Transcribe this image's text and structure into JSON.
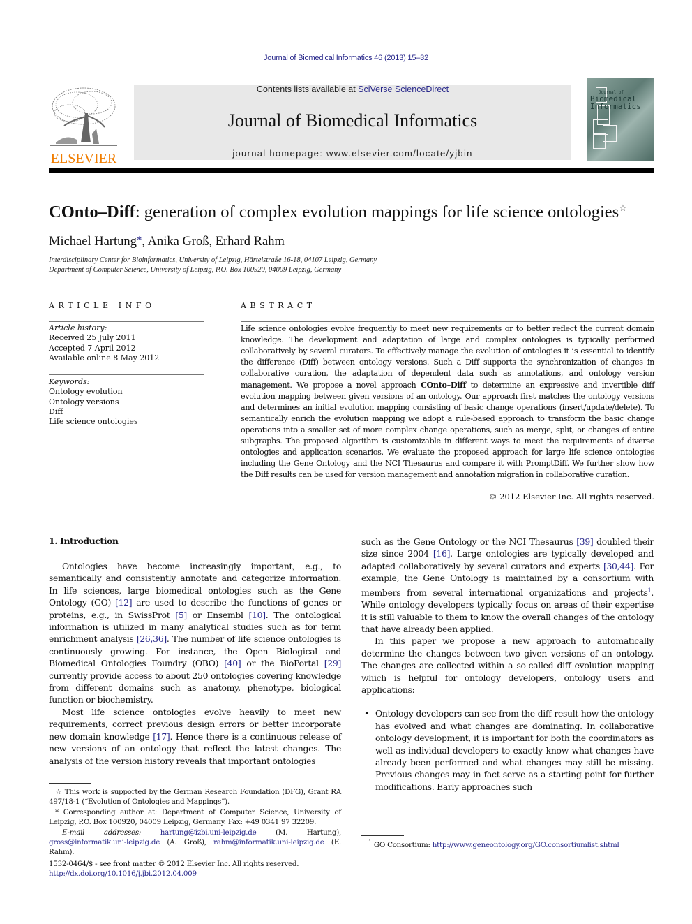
{
  "header": {
    "running_head": "Journal of Biomedical Informatics 46 (2013) 15–32",
    "contents_prefix": "Contents lists available at ",
    "contents_link": "SciVerse ScienceDirect",
    "journal_title": "Journal of Biomedical Informatics",
    "homepage_prefix": "journal homepage: ",
    "homepage_url": "www.elsevier.com/locate/yjbin",
    "publisher_logo_text": "ELSEVIER",
    "publisher_color": "#f07d00",
    "link_color": "#2a2a8c",
    "cover": {
      "line1": "Journal of",
      "line2": "Biomedical",
      "line3": "Informatics"
    }
  },
  "article": {
    "title_bold": "COnto–Diff",
    "title_rest": ": generation of complex evolution mappings for life science ontologies",
    "title_note_mark": "☆",
    "authors": [
      {
        "name": "Michael Hartung",
        "mark": "*"
      },
      {
        "name": ", Anika Groß, Erhard Rahm",
        "mark": ""
      }
    ],
    "affiliations": [
      "Interdisciplinary Center for Bioinformatics, University of Leipzig, Härtelstraße 16-18, 04107 Leipzig, Germany",
      "Department of Computer Science, University of Leipzig, P.O. Box 100920, 04009 Leipzig, Germany"
    ]
  },
  "article_info": {
    "heading": "ARTICLE INFO",
    "history_label": "Article history:",
    "history": [
      "Received 25 July 2011",
      "Accepted 7 April 2012",
      "Available online 8 May 2012"
    ],
    "keywords_label": "Keywords:",
    "keywords": [
      "Ontology evolution",
      "Ontology versions",
      "Diff",
      "Life science ontologies"
    ]
  },
  "abstract": {
    "heading": "ABSTRACT",
    "part1": "Life science ontologies evolve frequently to meet new requirements or to better reflect the current domain knowledge. The development and adaptation of large and complex ontologies is typically performed collaboratively by several curators. To effectively manage the evolution of ontologies it is essential to identify the difference (Diff) between ontology versions. Such a Diff supports the synchronization of changes in collaborative curation, the adaptation of dependent data such as annotations, and ontology version management. We propose a novel approach ",
    "bold": "COnto–Diff",
    "part2": " to determine an expressive and invertible diff evolution mapping between given versions of an ontology. Our approach first matches the ontology versions and determines an initial evolution mapping consisting of basic change operations (insert/update/delete). To semantically enrich the evolution mapping we adopt a rule-based approach to transform the basic change operations into a smaller set of more complex change operations, such as merge, split, or changes of entire subgraphs. The proposed algorithm is customizable in different ways to meet the requirements of diverse ontologies and application scenarios. We evaluate the proposed approach for large life science ontologies including the Gene Ontology and the NCI Thesaurus and compare it with PromptDiff. We further show how the Diff results can be used for version management and annotation migration in collaborative curation.",
    "copyright": "© 2012 Elsevier Inc. All rights reserved."
  },
  "intro": {
    "heading": "1. Introduction",
    "left": {
      "p1": [
        {
          "t": "Ontologies have become increasingly important, e.g., to semantically and consistently annotate and categorize information. In life sciences, large biomedical ontologies such as the Gene Ontology (GO) "
        },
        {
          "ref": "[12]"
        },
        {
          "t": " are used to describe the functions of genes or proteins, e.g., in SwissProt "
        },
        {
          "ref": "[5]"
        },
        {
          "t": " or Ensembl "
        },
        {
          "ref": "[10]"
        },
        {
          "t": ". The ontological information is utilized in many analytical studies such as for term enrichment analysis "
        },
        {
          "ref": "[26,36]"
        },
        {
          "t": ". The number of life science ontologies is continuously growing. For instance, the Open Biological and Biomedical Ontologies Foundry (OBO) "
        },
        {
          "ref": "[40]"
        },
        {
          "t": " or the BioPortal "
        },
        {
          "ref": "[29]"
        },
        {
          "t": " currently provide access to about 250 ontologies covering knowledge from different domains such as anatomy, phenotype, biological function or biochemistry."
        }
      ],
      "p2": [
        {
          "t": "Most life science ontologies evolve heavily to meet new requirements, correct previous design errors or better incorporate new domain knowledge "
        },
        {
          "ref": "[17]"
        },
        {
          "t": ". Hence there is a continuous release of new versions of an ontology that reflect the latest changes. The analysis of the version history reveals that important ontologies"
        }
      ]
    },
    "right": {
      "p1": [
        {
          "t": "such as the Gene Ontology or the NCI Thesaurus "
        },
        {
          "ref": "[39]"
        },
        {
          "t": " doubled their size since 2004 "
        },
        {
          "ref": "[16]"
        },
        {
          "t": ". Large ontologies are typically developed and adapted collaboratively by several curators and experts "
        },
        {
          "ref": "[30,44]"
        },
        {
          "t": ". For example, the Gene Ontology is maintained by a consortium with members from several international organizations and projects"
        },
        {
          "sup": "1"
        },
        {
          "t": ". While ontology developers typically focus on areas of their expertise it is still valuable to them to know the overall changes of the ontology that have already been applied."
        }
      ],
      "p2": "In this paper we propose a new approach to automatically determine the changes between two given versions of an ontology. The changes are collected within a so-called diff evolution mapping which is helpful for ontology developers, ontology users and applications:",
      "bullet1": "Ontology developers can see from the diff result how the ontology has evolved and what changes are dominating. In collaborative ontology development, it is important for both the coordinators as well as individual developers to exactly know what changes have already been performed and what changes may still be missing. Previous changes may in fact serve as a starting point for further modifications. Early approaches such"
    }
  },
  "footnotes": {
    "funding_mark": "☆",
    "funding": " This work is supported by the German Research Foundation (DFG), Grant RA 497/18-1 (“Evolution of Ontologies and Mappings”).",
    "corresponding_mark": "*",
    "corresponding": " Corresponding author at: Department of Computer Science, University of Leipzig, P.O. Box 100920, 04009 Leipzig, Germany. Fax: +49 0341 97 32209.",
    "email_label": "E-mail addresses:",
    "emails": [
      {
        "addr": "hartung@izbi.uni-leipzig.de",
        "who": " (M. Hartung), "
      },
      {
        "addr": "gross@informatik.uni-leipzig.de",
        "who": " (A. Groß), "
      },
      {
        "addr": "rahm@informatik.uni-leipzig.de",
        "who": " (E. Rahm)."
      }
    ],
    "issn": "1532-0464/$ - see front matter © 2012 Elsevier Inc. All rights reserved.",
    "doi": "http://dx.doi.org/10.1016/j.jbi.2012.04.009",
    "fn1_mark": "1",
    "fn1_label": "GO Consortium: ",
    "fn1_url": "http://www.geneontology.org/GO.consortiumlist.shtml"
  }
}
